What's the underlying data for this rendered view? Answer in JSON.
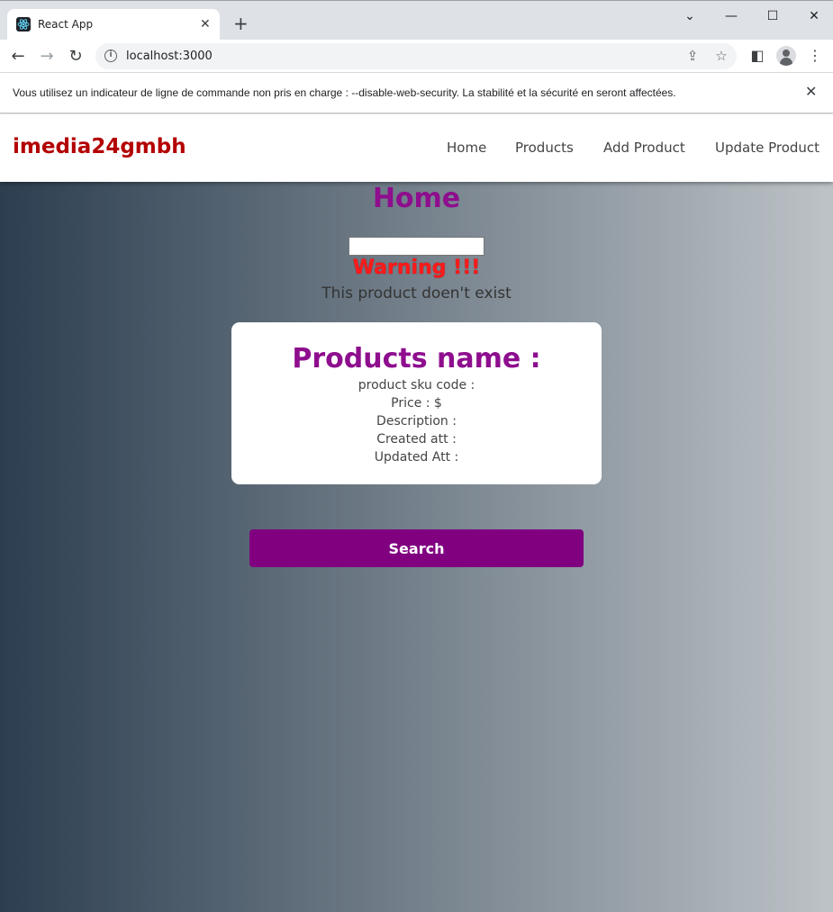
{
  "browser": {
    "tab_title": "React App",
    "url": "localhost:3000",
    "icons": {
      "favicon": "react-icon",
      "tab_close": "close-icon",
      "new_tab": "plus-icon",
      "minimize": "minimize-icon",
      "maximize": "maximize-icon",
      "close_window": "close-icon",
      "back": "back-arrow-icon",
      "forward": "forward-arrow-icon",
      "reload": "reload-icon",
      "info": "info-icon",
      "share": "share-icon",
      "bookmark": "star-icon",
      "side_panel": "side-panel-icon",
      "profile": "profile-icon",
      "menu": "kebab-menu-icon"
    }
  },
  "infobar": {
    "message": "Vous utilisez un indicateur de ligne de commande non pris en charge : --disable-web-security. La stabilité et la sécurité en seront affectées."
  },
  "navbar": {
    "brand": "imedia24gmbh",
    "links": [
      "Home",
      "Products",
      "Add Product",
      "Update Product"
    ]
  },
  "main": {
    "title": "Home",
    "search_value": "",
    "warning_title": "Warning !!!",
    "warning_message": "This product doen't exist",
    "card": {
      "title": "Products name :",
      "sku": "product sku code :",
      "price": "Price : $",
      "description": "Description :",
      "created": "Created att :",
      "updated": "Updated Att :"
    },
    "search_button": "Search"
  },
  "colors": {
    "brand": "#b30000",
    "accent": "#800080",
    "title": "#8e0e8e",
    "warning": "#ff1a1a",
    "gradient_start": "#2c3e50",
    "gradient_end": "#bdc3c7"
  }
}
